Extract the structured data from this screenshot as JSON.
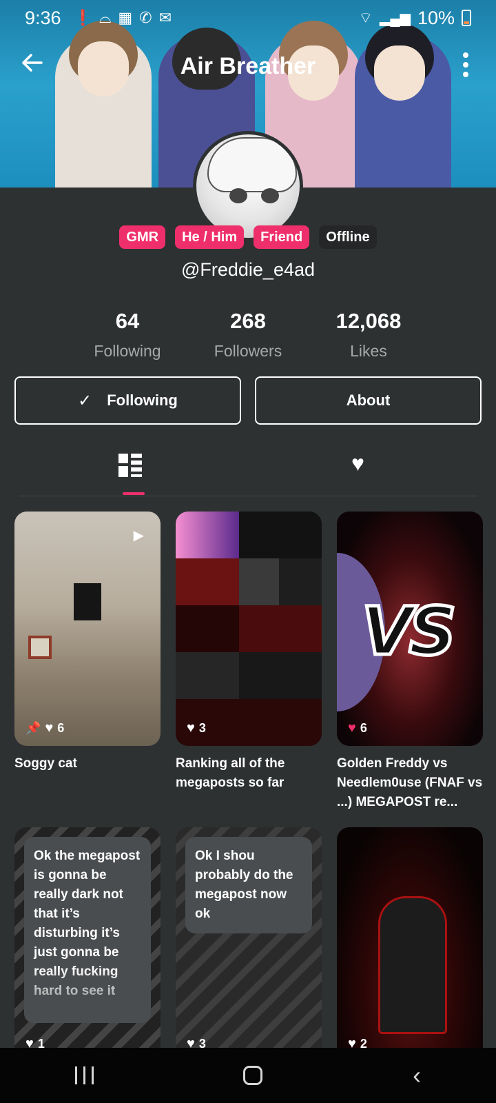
{
  "status_bar": {
    "time": "9:36",
    "battery": "10%"
  },
  "app_bar": {
    "title": "Air Breather"
  },
  "tags": [
    {
      "label": "GMR"
    },
    {
      "label": "He / Him"
    },
    {
      "label": "Friend"
    },
    {
      "label": "Offline"
    }
  ],
  "handle": "@Freddie_e4ad",
  "stats": [
    {
      "value": "64",
      "label": "Following"
    },
    {
      "value": "268",
      "label": "Followers"
    },
    {
      "value": "12,068",
      "label": "Likes"
    }
  ],
  "buttons": {
    "following": "Following",
    "about": "About"
  },
  "posts": [
    {
      "title": "Soggy cat",
      "likes": "6"
    },
    {
      "title": "Ranking all of the megaposts so far",
      "likes": "3"
    },
    {
      "title": "Golden Freddy vs Needlem0use (FNAF vs ...) MEGAPOST re...",
      "likes": "6"
    },
    {
      "bubble": "Ok the megapost is gonna be really dark not that it’s disturbing it’s just gonna be really fucking hard to see it",
      "likes": "1"
    },
    {
      "bubble": "Ok I shou probably do the megapost now ok",
      "likes": "3"
    },
    {
      "likes": "2"
    }
  ]
}
